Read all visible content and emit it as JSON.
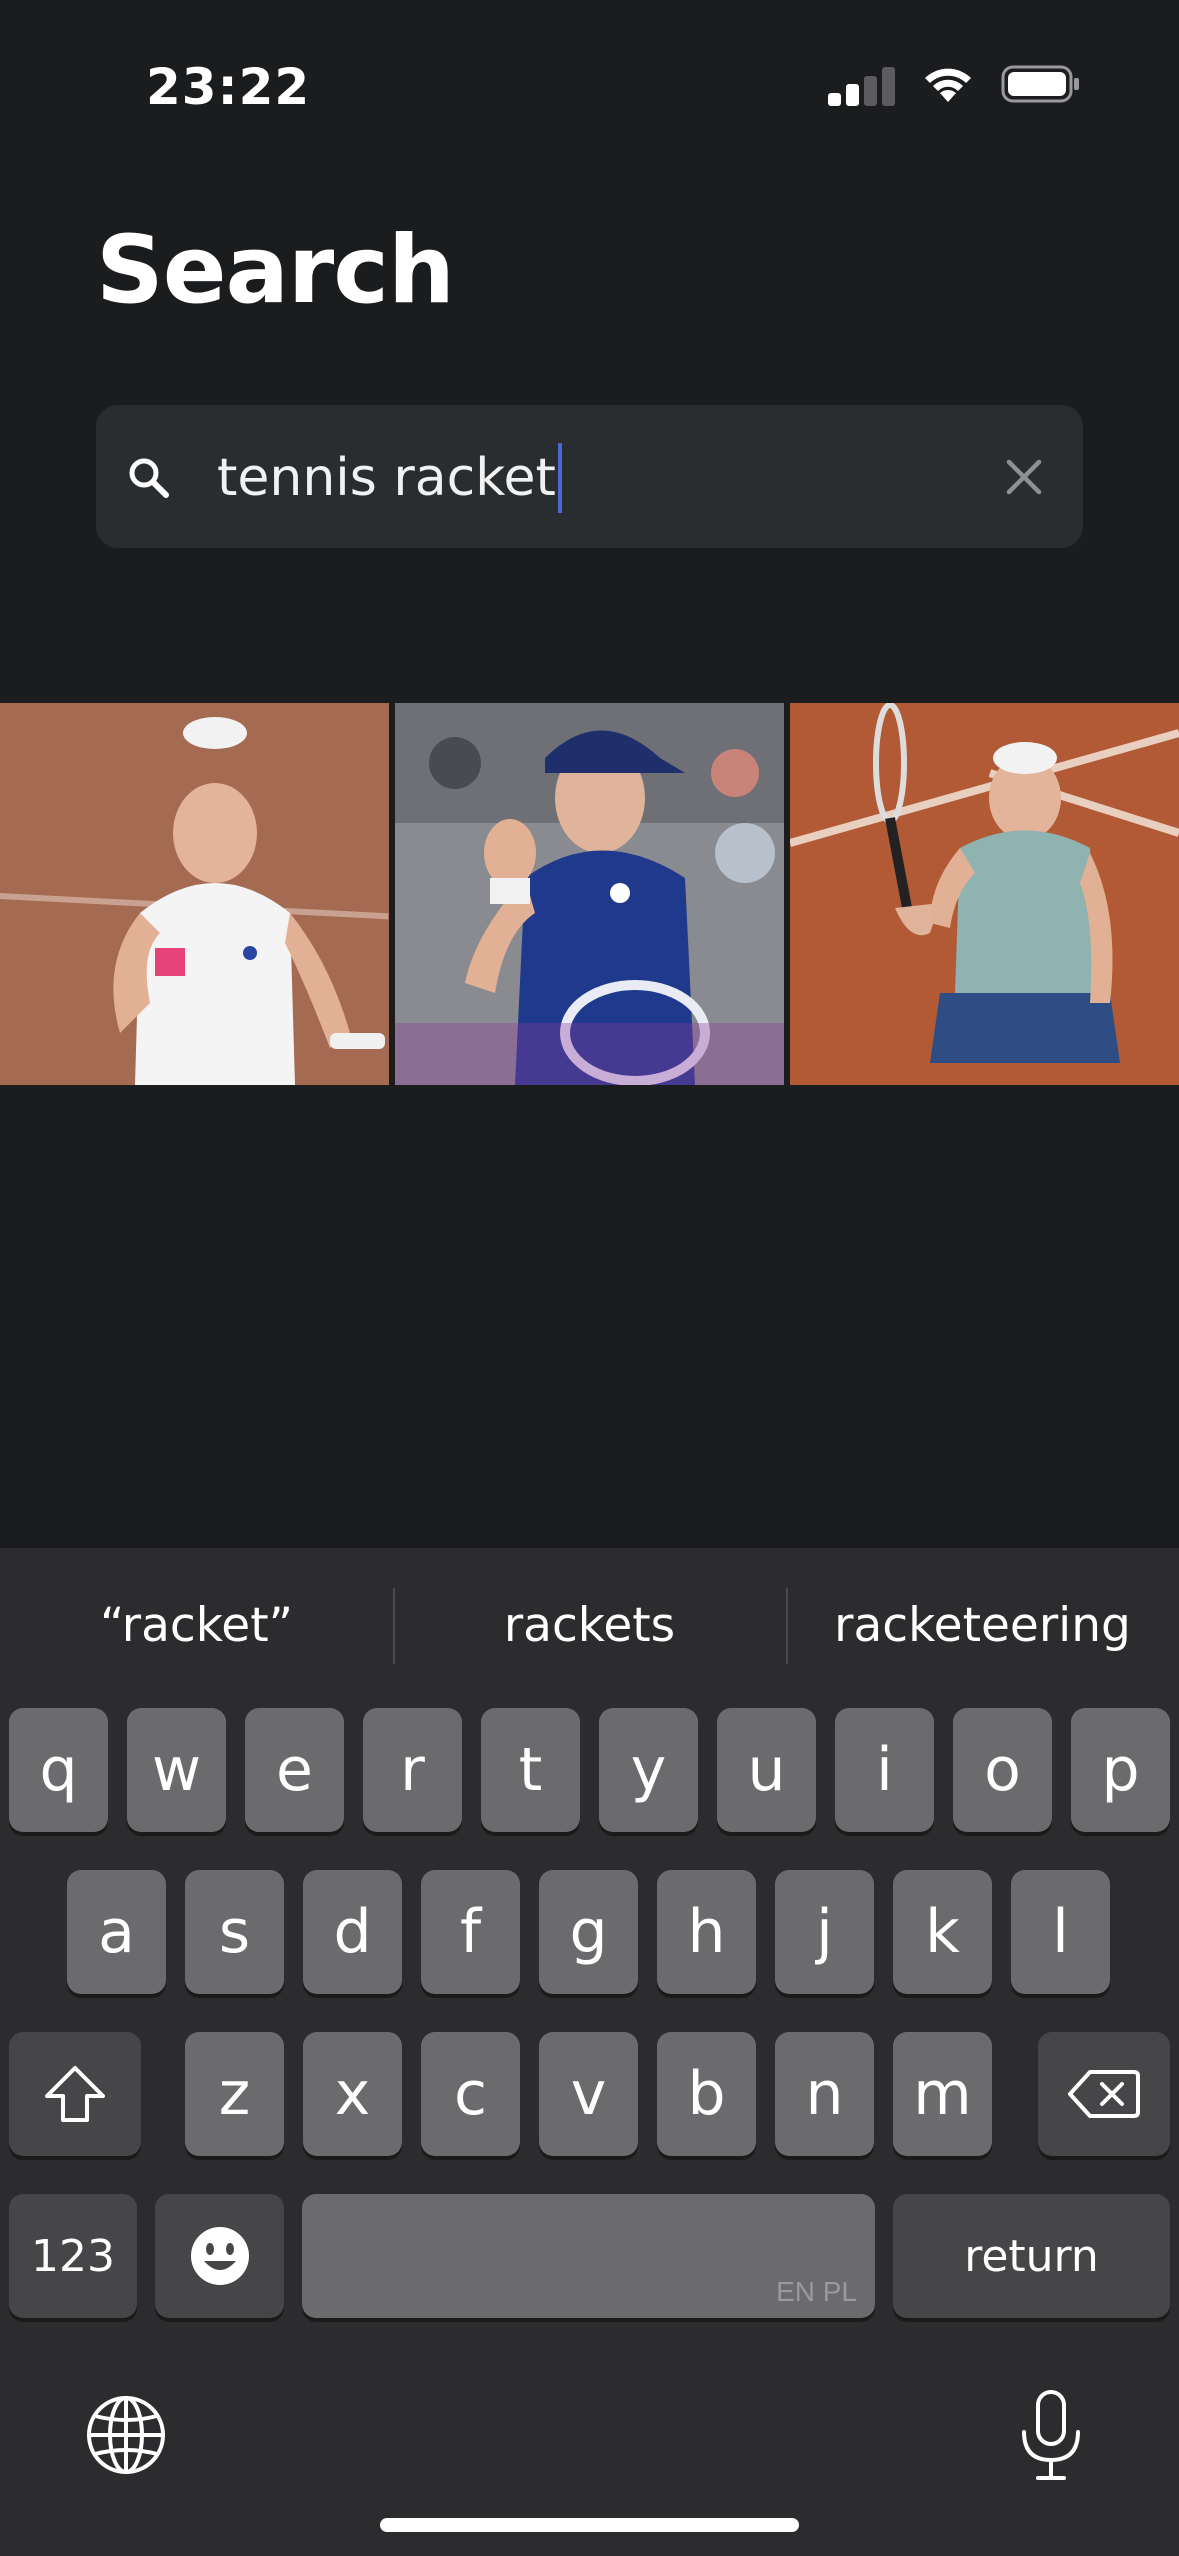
{
  "status_bar": {
    "time": "23:22",
    "battery_icon": "battery-icon",
    "wifi_icon": "wifi-icon",
    "signal_icon": "cellular-signal-icon"
  },
  "header": {
    "title": "Search"
  },
  "search": {
    "query": "tennis racket",
    "search_icon": "search-icon",
    "clear_icon": "close-icon"
  },
  "results": {
    "images": [
      {
        "description_icon": "photo-tennis-player-white-outfit"
      },
      {
        "description_icon": "photo-tennis-player-navy-outfit"
      },
      {
        "description_icon": "photo-tennis-player-racket-raised"
      }
    ]
  },
  "keyboard": {
    "suggestions": [
      "“racket”",
      "rackets",
      "racketeering"
    ],
    "row1": [
      "q",
      "w",
      "e",
      "r",
      "t",
      "y",
      "u",
      "i",
      "o",
      "p"
    ],
    "row2": [
      "a",
      "s",
      "d",
      "f",
      "g",
      "h",
      "j",
      "k",
      "l"
    ],
    "row3": [
      "z",
      "x",
      "c",
      "v",
      "b",
      "n",
      "m"
    ],
    "numbers_label": "123",
    "return_label": "return",
    "space_languages": "EN PL",
    "shift_icon": "shift-icon",
    "delete_icon": "delete-icon",
    "emoji_icon": "emoji-icon",
    "globe_icon": "globe-icon",
    "mic_icon": "microphone-icon"
  },
  "colors": {
    "background": "#1b1c1e",
    "search_field": "#2a2d30",
    "caret": "#4d66d8",
    "key": "#6b6b6e",
    "key_dark": "#464648"
  }
}
